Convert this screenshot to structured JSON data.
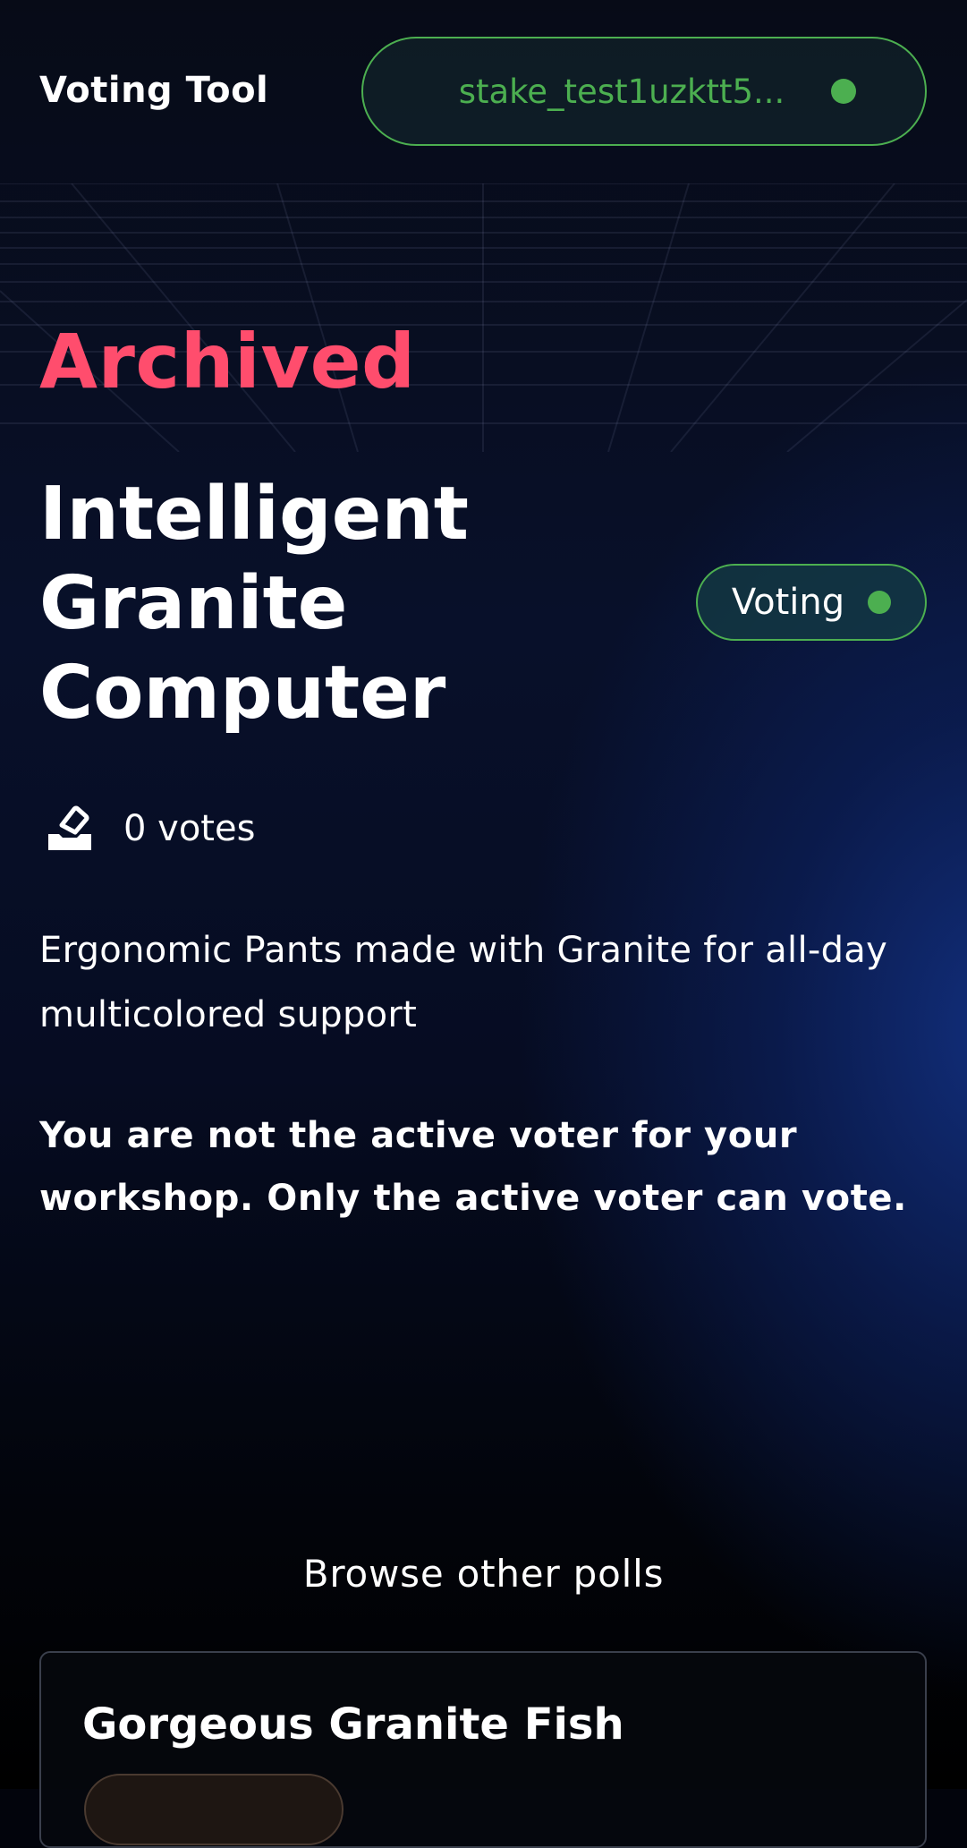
{
  "header": {
    "app_title": "Voting Tool",
    "wallet_address": "stake_test1uzktt5..."
  },
  "poll": {
    "state": "Archived",
    "title": "Intelligent Granite Computer",
    "status_label": "Voting",
    "votes_text": "0 votes",
    "description": "Ergonomic Pants made with Granite for all-day multicolored support",
    "notice": "You are not the active voter for your workshop. Only the active voter can vote."
  },
  "browse": {
    "label": "Browse other polls",
    "items": [
      {
        "title": "Gorgeous Granite Fish"
      }
    ]
  },
  "colors": {
    "accent_green": "#4caf50",
    "archived_red": "#ff4d6d",
    "background": "#02040c"
  },
  "icons": {
    "wallet_status": "status-dot",
    "votes": "ballot-box-icon"
  }
}
